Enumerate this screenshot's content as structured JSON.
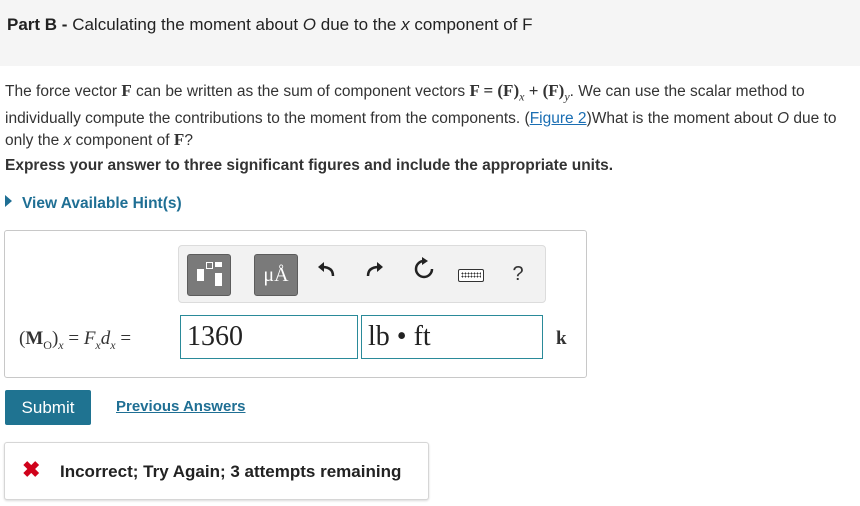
{
  "header": {
    "part_label": "Part B -",
    "title_before_O": "Calculating the moment about",
    "O": "O",
    "title_mid": "due to the",
    "x": "x",
    "title_end": "component of F"
  },
  "problem": {
    "line1": "The force vector",
    "F": "F",
    "line1b": "can be written as the sum of component vectors",
    "equation": "F = (F)x + (F)y",
    "line1c": ". We can use the scalar",
    "line2": "method to individually compute the contributions to the moment from the components. (",
    "figure_link": "Figure 2",
    "line2b": ")What is the moment",
    "line3a": "about",
    "O": "O",
    "line3b": "due to only the",
    "x": "x",
    "line3c": "component of",
    "q": "?"
  },
  "instruction": "Express your answer to three significant figures and include the appropriate units.",
  "hint_label": "View Available Hint(s)",
  "toolbar": {
    "units_label": "μÅ",
    "undo_icon": "undo-icon",
    "redo_icon": "redo-icon",
    "reset_icon": "reset-icon",
    "keyboard_icon": "keyboard-icon",
    "help_label": "?"
  },
  "answer": {
    "expression": "(MO)x = Fxdx =",
    "value": "1360",
    "units": "lb • ft",
    "direction": "k"
  },
  "submit_label": "Submit",
  "previous_answers_label": "Previous Answers",
  "feedback": {
    "icon": "error-x-icon",
    "text": "Incorrect; Try Again; 3 attempts remaining",
    "color": "#d0021b"
  }
}
